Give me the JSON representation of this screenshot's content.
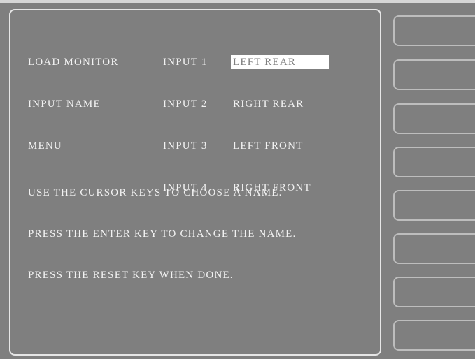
{
  "menu": {
    "title_lines": [
      "LOAD MONITOR",
      "INPUT NAME",
      "MENU"
    ]
  },
  "inputs": [
    {
      "label": "INPUT 1",
      "name": "LEFT REAR",
      "selected": true
    },
    {
      "label": "INPUT 2",
      "name": "RIGHT REAR",
      "selected": false
    },
    {
      "label": "INPUT 3",
      "name": "LEFT FRONT",
      "selected": false
    },
    {
      "label": "INPUT 4",
      "name": "RIGHT FRONT",
      "selected": false
    }
  ],
  "instructions": [
    "USE THE CURSOR KEYS TO CHOOSE A NAME.",
    "PRESS THE ENTER KEY TO CHANGE THE NAME.",
    "PRESS THE RESET KEY WHEN DONE."
  ],
  "softkeys": [
    "",
    "",
    "",
    "",
    "",
    "",
    "",
    ""
  ]
}
